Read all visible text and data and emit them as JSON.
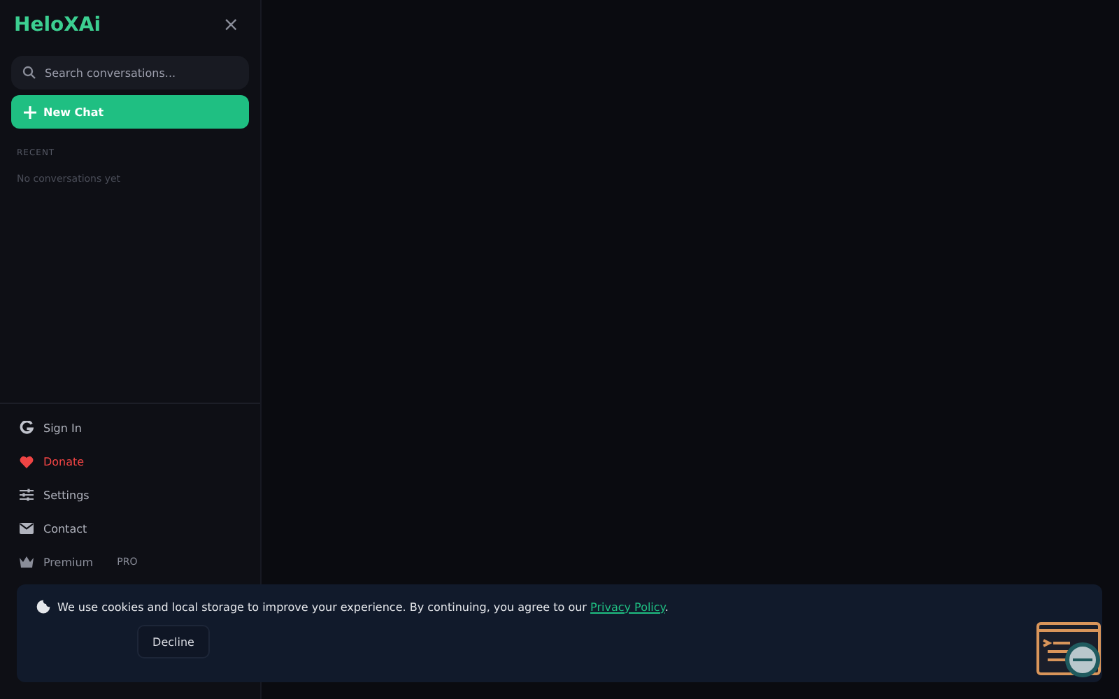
{
  "sidebar": {
    "logo": "HeloXAi",
    "close": "×",
    "search": {
      "placeholder": "Search conversations..."
    },
    "new_chat": "New Chat",
    "section": "RECENT",
    "empty": "No conversations yet",
    "menu": [
      {
        "kind": "google",
        "label": "Sign In"
      },
      {
        "kind": "heart",
        "label": "Donate"
      },
      {
        "kind": "settings",
        "label": "Settings"
      },
      {
        "kind": "mail",
        "label": "Contact"
      },
      {
        "kind": "crown",
        "label": "Premium",
        "badge": "PRO"
      }
    ]
  },
  "cookie_banner": {
    "text": "We use cookies and local storage to improve your experience. By continuing, you agree to our ",
    "link": "Privacy Policy",
    "after": ".",
    "button": "Decline"
  }
}
